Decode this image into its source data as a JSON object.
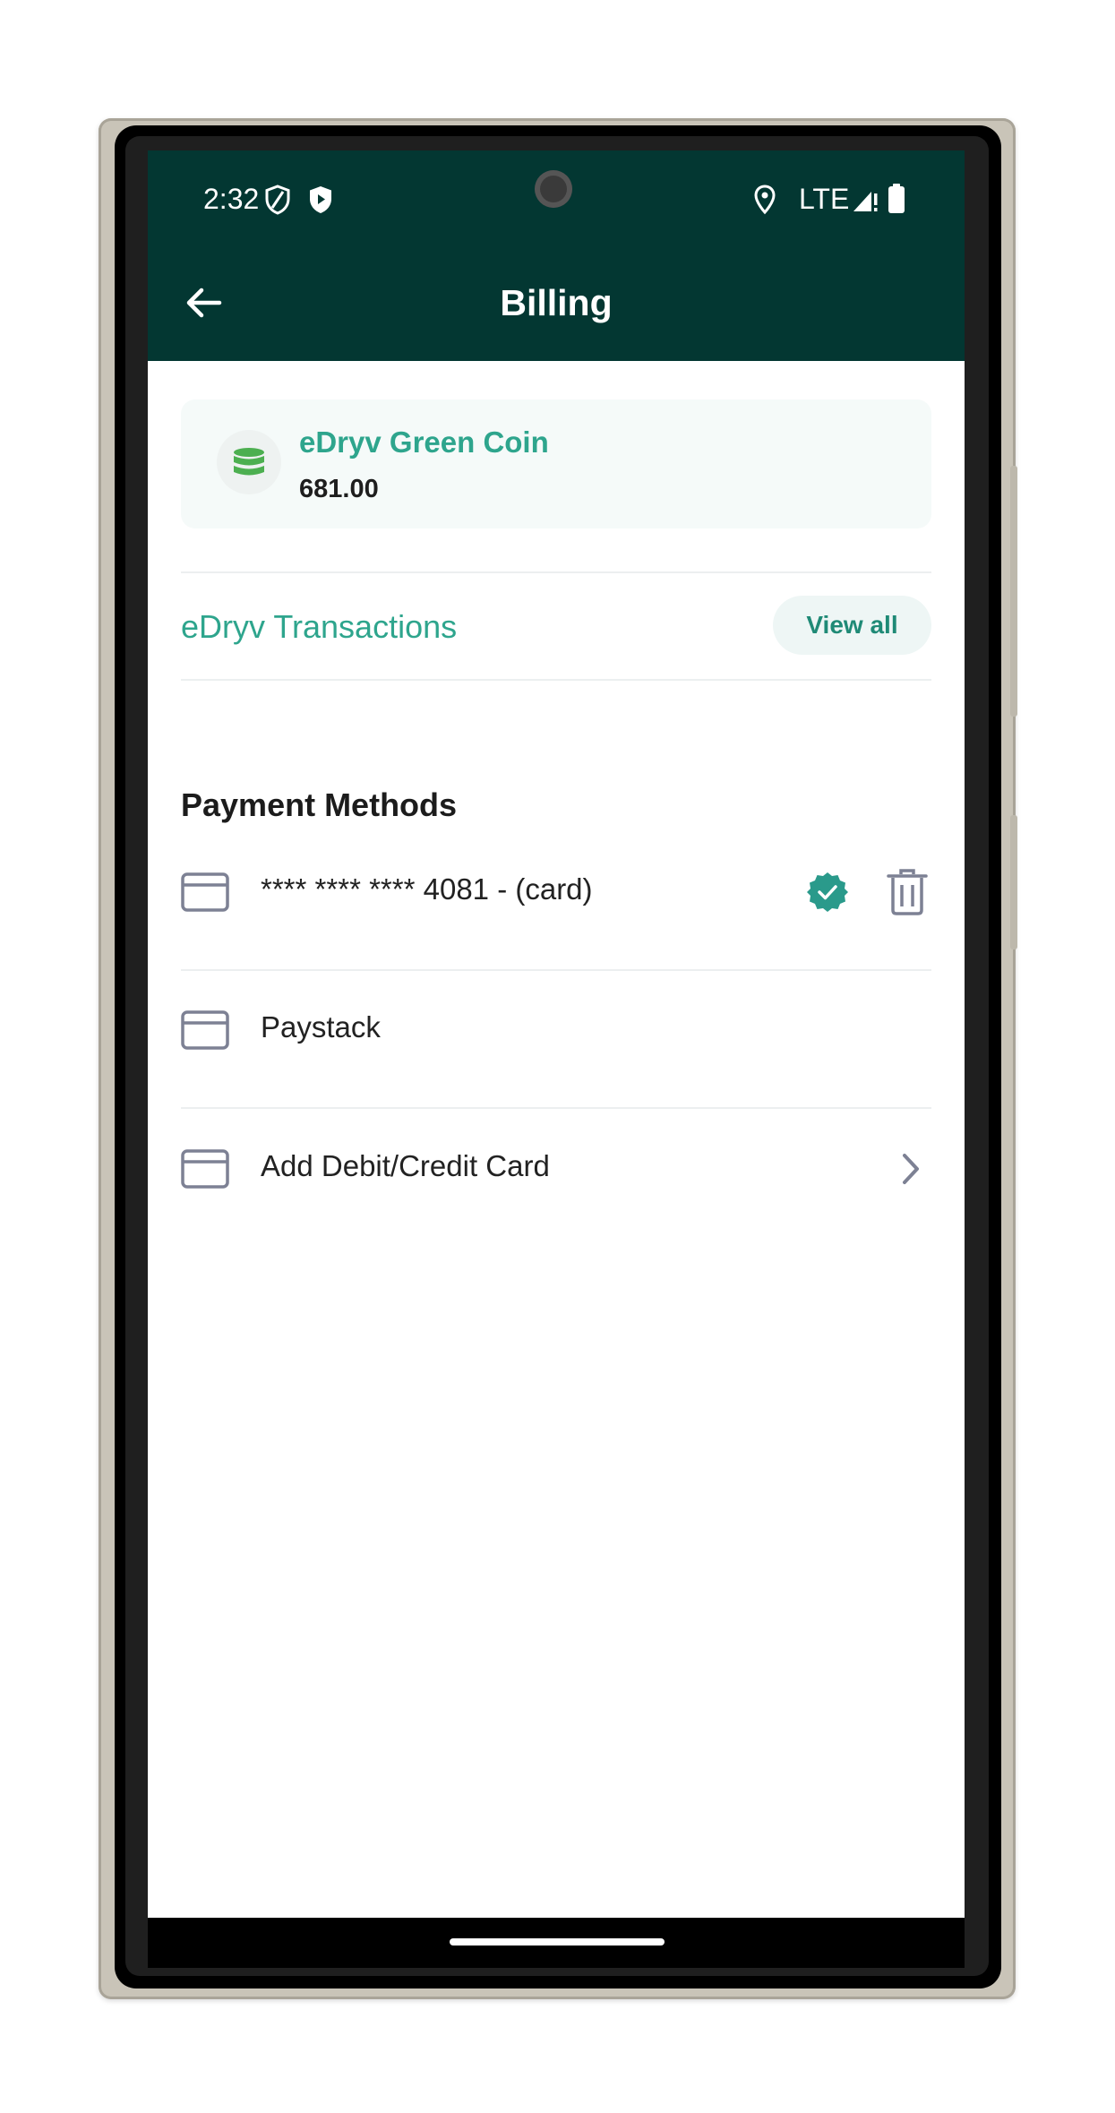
{
  "status_bar": {
    "time": "2:32",
    "network": "LTE"
  },
  "app_bar": {
    "title": "Billing"
  },
  "coin": {
    "name": "eDryv Green Coin",
    "balance": "681.00"
  },
  "transactions": {
    "label": "eDryv Transactions",
    "view_all_label": "View all"
  },
  "payment_methods": {
    "title": "Payment Methods",
    "items": [
      {
        "label": "**** **** **** 4081 - (card)"
      },
      {
        "label": "Paystack"
      },
      {
        "label": "Add Debit/Credit Card"
      }
    ]
  },
  "colors": {
    "app_bar": "#033732",
    "accent": "#2ea58d",
    "coin_icon": "#4caf50"
  }
}
